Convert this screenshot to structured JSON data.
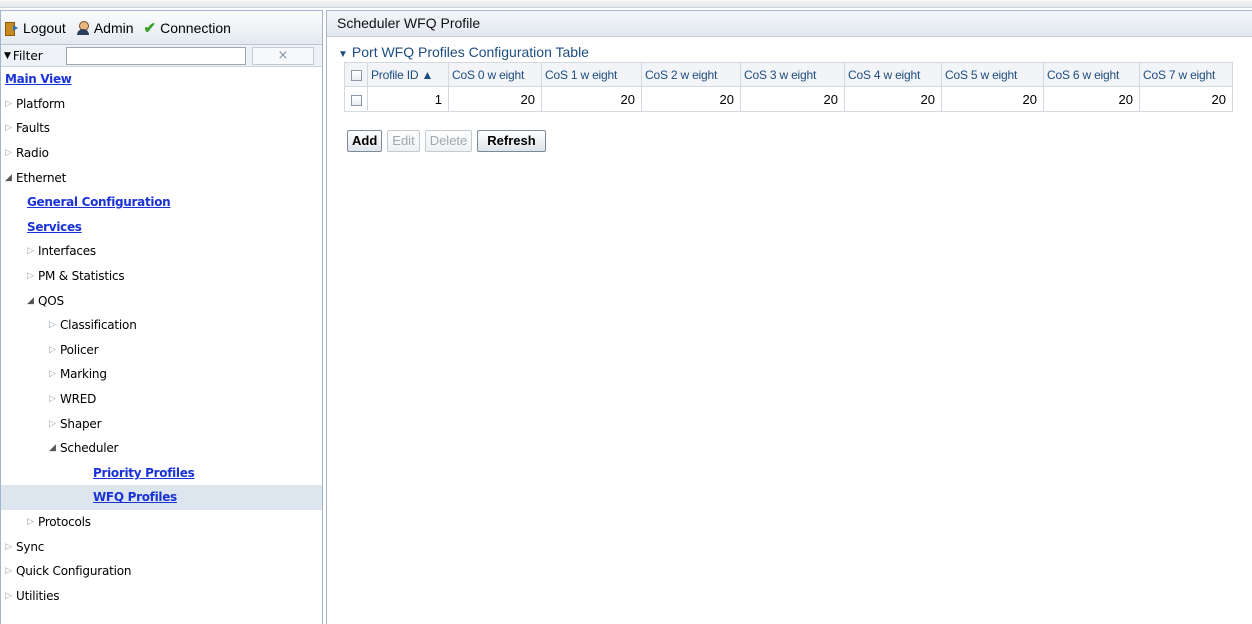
{
  "toolbar": {
    "logout_label": "Logout",
    "admin_label": "Admin",
    "connection_label": "Connection"
  },
  "filter": {
    "label": "Filter",
    "value": "",
    "clear_label": "×"
  },
  "tree": {
    "main_view": "Main View",
    "platform": "Platform",
    "faults": "Faults",
    "radio": "Radio",
    "ethernet": "Ethernet",
    "general_configuration": "General Configuration",
    "services": "Services",
    "interfaces": "Interfaces",
    "pm_statistics": "PM & Statistics",
    "qos": "QOS",
    "classification": "Classification",
    "policer": "Policer",
    "marking": "Marking",
    "wred": "WRED",
    "shaper": "Shaper",
    "scheduler": "Scheduler",
    "priority_profiles": "Priority Profiles",
    "wfq_profiles": "WFQ Profiles",
    "protocols": "Protocols",
    "sync": "Sync",
    "quick_configuration": "Quick Configuration",
    "utilities": "Utilities"
  },
  "main": {
    "title": "Scheduler WFQ Profile",
    "section_title": "Port WFQ Profiles Configuration Table",
    "columns": [
      "Profile ID ▲",
      "CoS 0 w eight",
      "CoS 1 w eight",
      "CoS 2 w eight",
      "CoS 3 w eight",
      "CoS 4 w eight",
      "CoS 5 w eight",
      "CoS 6 w eight",
      "CoS 7 w eight"
    ],
    "rows": [
      [
        "1",
        "20",
        "20",
        "20",
        "20",
        "20",
        "20",
        "20",
        "20"
      ]
    ],
    "buttons": {
      "add": "Add",
      "edit": "Edit",
      "delete": "Delete",
      "refresh": "Refresh"
    }
  }
}
